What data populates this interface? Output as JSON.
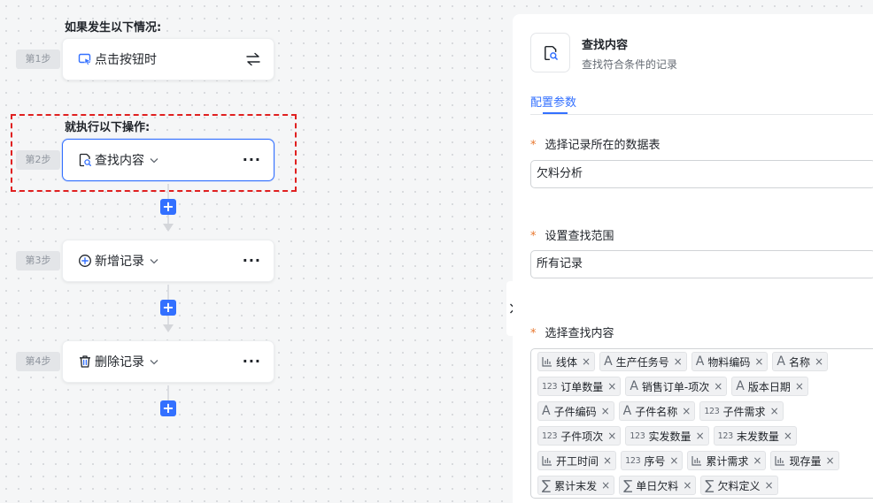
{
  "flow": {
    "trigger_heading": "如果发生以下情况:",
    "action_heading": "就执行以下操作:",
    "steps": [
      {
        "tag": "第1步",
        "title": "点击按钮时",
        "icon": "cursor-click-icon",
        "right_icon": "swap-arrows-icon"
      },
      {
        "tag": "第2步",
        "title": "查找内容",
        "icon": "find-record-icon",
        "right_icon": "more-icon",
        "selected": true
      },
      {
        "tag": "第3步",
        "title": "新增记录",
        "icon": "add-circle-icon",
        "right_icon": "more-icon"
      },
      {
        "tag": "第4步",
        "title": "删除记录",
        "icon": "trash-icon",
        "right_icon": "more-icon"
      }
    ],
    "add_label": "+",
    "more_label": "···"
  },
  "panel": {
    "icon": "find-record-icon",
    "title": "查找内容",
    "subtitle": "查找符合条件的记录",
    "tab": "配置参数",
    "required_mark": "*",
    "fields": [
      {
        "label": "选择记录所在的数据表",
        "value": "欠料分析"
      },
      {
        "label": "设置查找范围",
        "value": "所有记录"
      },
      {
        "label": "选择查找内容"
      }
    ],
    "tags": [
      [
        {
          "type": "chart",
          "label": "线体"
        },
        {
          "type": "text",
          "label": "生产任务号"
        },
        {
          "type": "text",
          "label": "物料编码"
        },
        {
          "type": "text",
          "label": "名称"
        }
      ],
      [
        {
          "type": "number",
          "label": "订单数量"
        },
        {
          "type": "text",
          "label": "销售订单-项次"
        },
        {
          "type": "text",
          "label": "版本日期"
        }
      ],
      [
        {
          "type": "text",
          "label": "子件编码"
        },
        {
          "type": "text",
          "label": "子件名称"
        },
        {
          "type": "number",
          "label": "子件需求"
        }
      ],
      [
        {
          "type": "number",
          "label": "子件项次"
        },
        {
          "type": "number",
          "label": "实发数量"
        },
        {
          "type": "number",
          "label": "末发数量"
        }
      ],
      [
        {
          "type": "chart",
          "label": "开工时间"
        },
        {
          "type": "number",
          "label": "序号"
        },
        {
          "type": "chart",
          "label": "累计需求"
        },
        {
          "type": "chart",
          "label": "现存量"
        }
      ],
      [
        {
          "type": "sum",
          "label": "累计末发"
        },
        {
          "type": "sum",
          "label": "单日欠料"
        },
        {
          "type": "sum",
          "label": "欠料定义"
        }
      ]
    ],
    "type_glyphs": {
      "text": "A",
      "number": "123",
      "sum": "∑",
      "chart": "chart"
    },
    "remove_glyph": "×"
  },
  "colors": {
    "accent": "#3370ff",
    "danger": "#e02020",
    "required": "#e8772e"
  }
}
